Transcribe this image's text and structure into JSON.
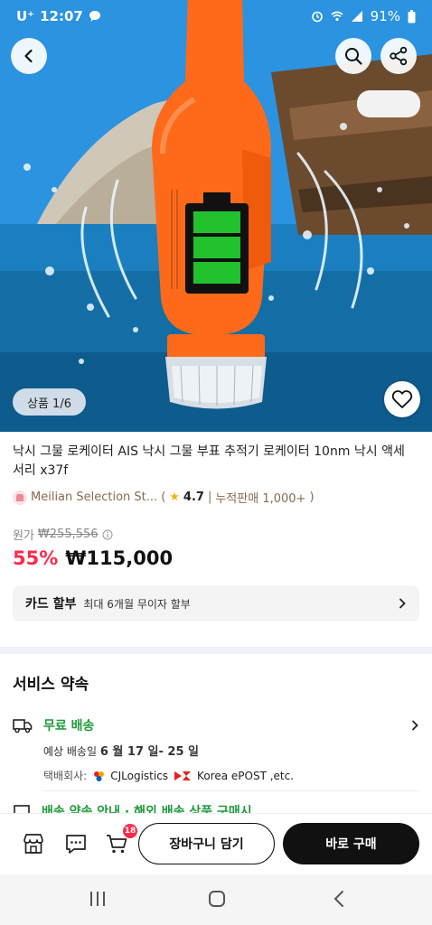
{
  "status_bar": {
    "carrier": "U⁺",
    "time": "12:07",
    "battery": "91%"
  },
  "hero": {
    "image_counter": "상품 1/6",
    "colors": {
      "sea": "#1b7fbf",
      "device": "#ff6a1a",
      "battery_green": "#22c22e"
    },
    "icons": [
      "back-arrow-icon",
      "search-icon",
      "share-icon",
      "heart-icon"
    ]
  },
  "product": {
    "title": "낙시 그물 로케이터 AIS 낙시 그물 부표 추적기 로케이터 10nm 낙시 액세서리 x37f",
    "seller_name": "Meilian Selection St...",
    "rating": "4.7",
    "sales_text": "누적판매 1,000+",
    "original_price_label": "원가",
    "original_price": "₩255,556",
    "discount": "55%",
    "price": "₩115,000",
    "card_label": "카드 할부",
    "card_desc": "최대 6개월 무이자 할부"
  },
  "service": {
    "title": "서비스 약속",
    "free_shipping": "무료 배송",
    "delivery_prefix": "예상 배송일",
    "delivery_dates": "6 월 17 일- 25 일",
    "carrier_label": "택배회사:",
    "carrier_1": "CJLogistics",
    "carrier_2": "Korea ePOST ,etc.",
    "promise_partial": "배송 약속 안내 · 해외 배송 상품 구매시"
  },
  "action_bar": {
    "cart_badge": "18",
    "add_to_cart": "장바구니 담기",
    "buy_now": "바로 구매"
  }
}
